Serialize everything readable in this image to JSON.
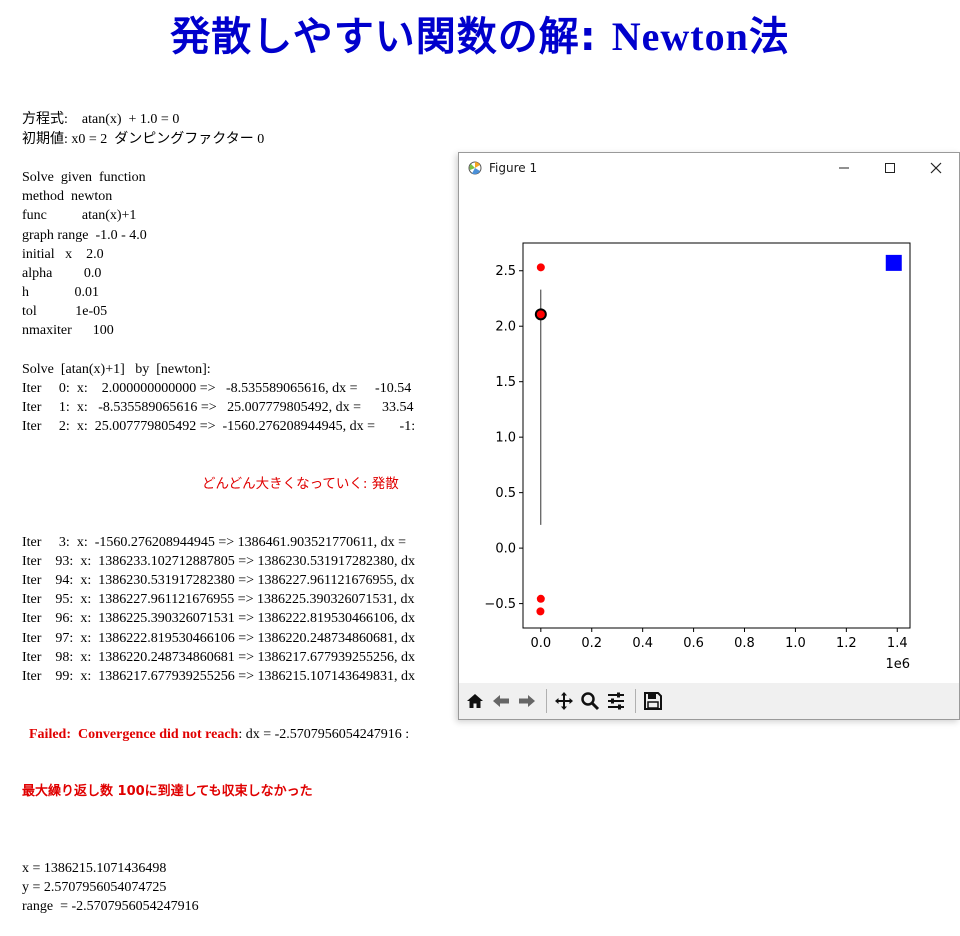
{
  "slide": {
    "title_jp": "発散しやすい関数の解: ",
    "title_latin": "Newton法"
  },
  "console": {
    "lines": [
      "方程式:    atan(x)  + 1.0 = 0",
      "初期値: x0 = 2  ダンピングファクター 0",
      "",
      "Solve  given  function",
      "method  newton",
      "func          atan(x)+1",
      "graph range  -1.0 - 4.0",
      "initial   x    2.0",
      "alpha         0.0",
      "h             0.01",
      "tol           1e-05",
      "nmaxiter      100",
      "",
      "Solve  [atan(x)+1]   by  [newton]:",
      "Iter     0:  x:    2.000000000000 =>   -8.535589065616, dx =     -10.54",
      "Iter     1:  x:   -8.535589065616 =>   25.007779805492, dx =      33.54",
      "Iter     2:  x:  25.007779805492 =>  -1560.276208944945, dx =       -1:"
    ],
    "note_diverge": "どんどん大きくなっていく: 発散",
    "lines2": [
      "Iter     3:  x:  -1560.276208944945 => 1386461.903521770611, dx = ",
      "Iter    93:  x:  1386233.102712887805 => 1386230.531917282380, dx",
      "Iter    94:  x:  1386230.531917282380 => 1386227.961121676955, dx",
      "Iter    95:  x:  1386227.961121676955 => 1386225.390326071531, dx",
      "Iter    96:  x:  1386225.390326071531 => 1386222.819530466106, dx",
      "Iter    97:  x:  1386222.819530466106 => 1386220.248734860681, dx",
      "Iter    98:  x:  1386220.248734860681 => 1386217.677939255256, dx",
      "Iter    99:  x:  1386217.677939255256 => 1386215.107143649831, dx"
    ],
    "fail_label": "  Failed:  Convergence did not reach",
    "fail_rest": ": dx = -2.5707956054247916 :",
    "fail_jp": "最大繰り返し数 100に到達しても収束しなかった",
    "results": [
      "",
      "x = 1386215.1071436498",
      "y = 2.5707956054074725",
      "range  = -2.5707956054247916"
    ]
  },
  "figure_window": {
    "title": "Figure 1",
    "minimize_icon": "minimize-icon",
    "maximize_icon": "maximize-icon",
    "close_icon": "close-icon",
    "toolbar": [
      "home-icon",
      "back-icon",
      "forward-icon",
      "pan-icon",
      "zoom-icon",
      "configure-subplots-icon",
      "save-icon"
    ]
  },
  "chart_data": {
    "type": "scatter",
    "title": "",
    "xlabel": "",
    "ylabel": "",
    "x_offset_label": "1e6",
    "xlim": [
      -70000,
      1450000
    ],
    "ylim": [
      -0.72,
      2.75
    ],
    "xticks": [
      0.0,
      0.2,
      0.4,
      0.6,
      0.8,
      1.0,
      1.2,
      1.4
    ],
    "xtick_labels": [
      "0.0",
      "0.2",
      "0.4",
      "0.6",
      "0.8",
      "1.0",
      "1.2",
      "1.4"
    ],
    "yticks": [
      -0.5,
      0.0,
      0.5,
      1.0,
      1.5,
      2.0,
      2.5
    ],
    "ytick_labels": [
      "−0.5",
      "0.0",
      "0.5",
      "1.0",
      "1.5",
      "2.0",
      "2.5"
    ],
    "grid": false,
    "points_red": [
      {
        "x": 2.0,
        "y": 2.107
      },
      {
        "x": -8.5356,
        "y": -0.4568
      },
      {
        "x": 25.0078,
        "y": 2.5308
      },
      {
        "x": -1560.28,
        "y": -0.5701
      }
    ],
    "start_point": {
      "x": 2.0,
      "y": 2.107
    },
    "final_point": {
      "x": 1386215.107,
      "y": 2.5708
    },
    "vertical_line": {
      "x": 2.0,
      "y_from": 0.21,
      "y_to": 2.33
    },
    "colors": {
      "points": "#ff0000",
      "final": "#0000ff",
      "start_edge": "#000000",
      "line": "#000000"
    }
  }
}
